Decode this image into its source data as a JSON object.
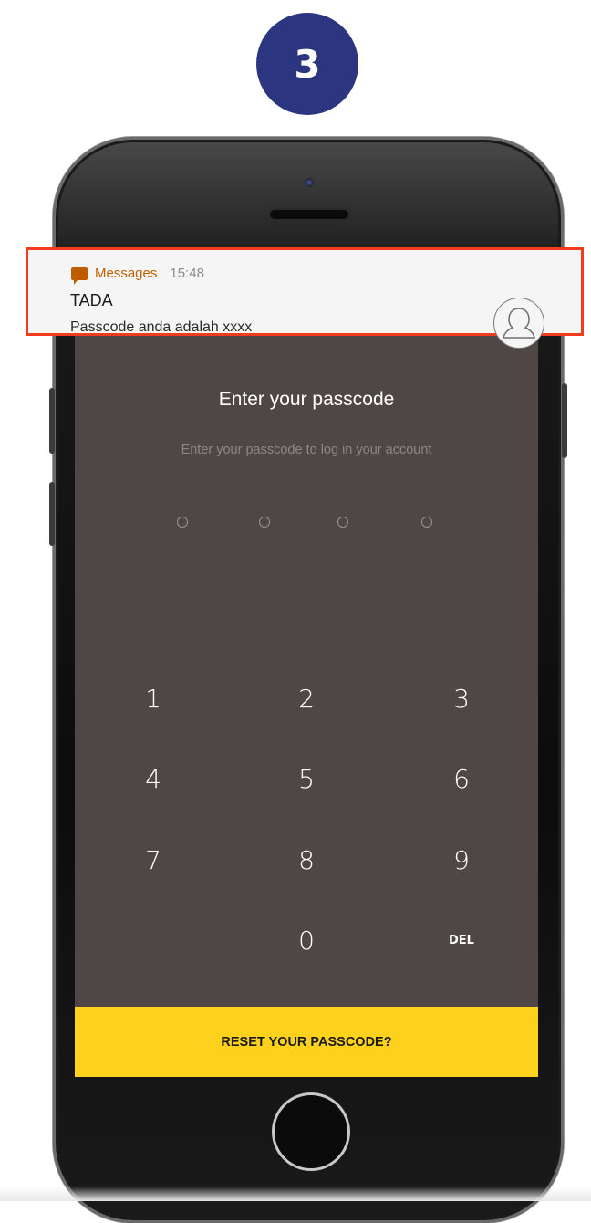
{
  "step": {
    "number": "3",
    "color": "#2b3580"
  },
  "notification": {
    "app_icon": "message-bubble-icon",
    "app_name": "Messages",
    "time": "15:48",
    "sender": "TADA",
    "text": "Passcode anda adalah xxxx",
    "avatar_icon": "person-avatar-icon",
    "highlight_color": "#f53b1e"
  },
  "screen": {
    "title": "Enter your passcode",
    "subtitle": "Enter your passcode to log in your account",
    "passcode_dots": 4,
    "keypad": {
      "k1": "1",
      "k2": "2",
      "k3": "3",
      "k4": "4",
      "k5": "5",
      "k6": "6",
      "k7": "7",
      "k8": "8",
      "k9": "9",
      "k0": "0",
      "del": "DEL"
    },
    "reset_label": "RESET YOUR PASSCODE?",
    "accent_color": "#fed21c"
  }
}
